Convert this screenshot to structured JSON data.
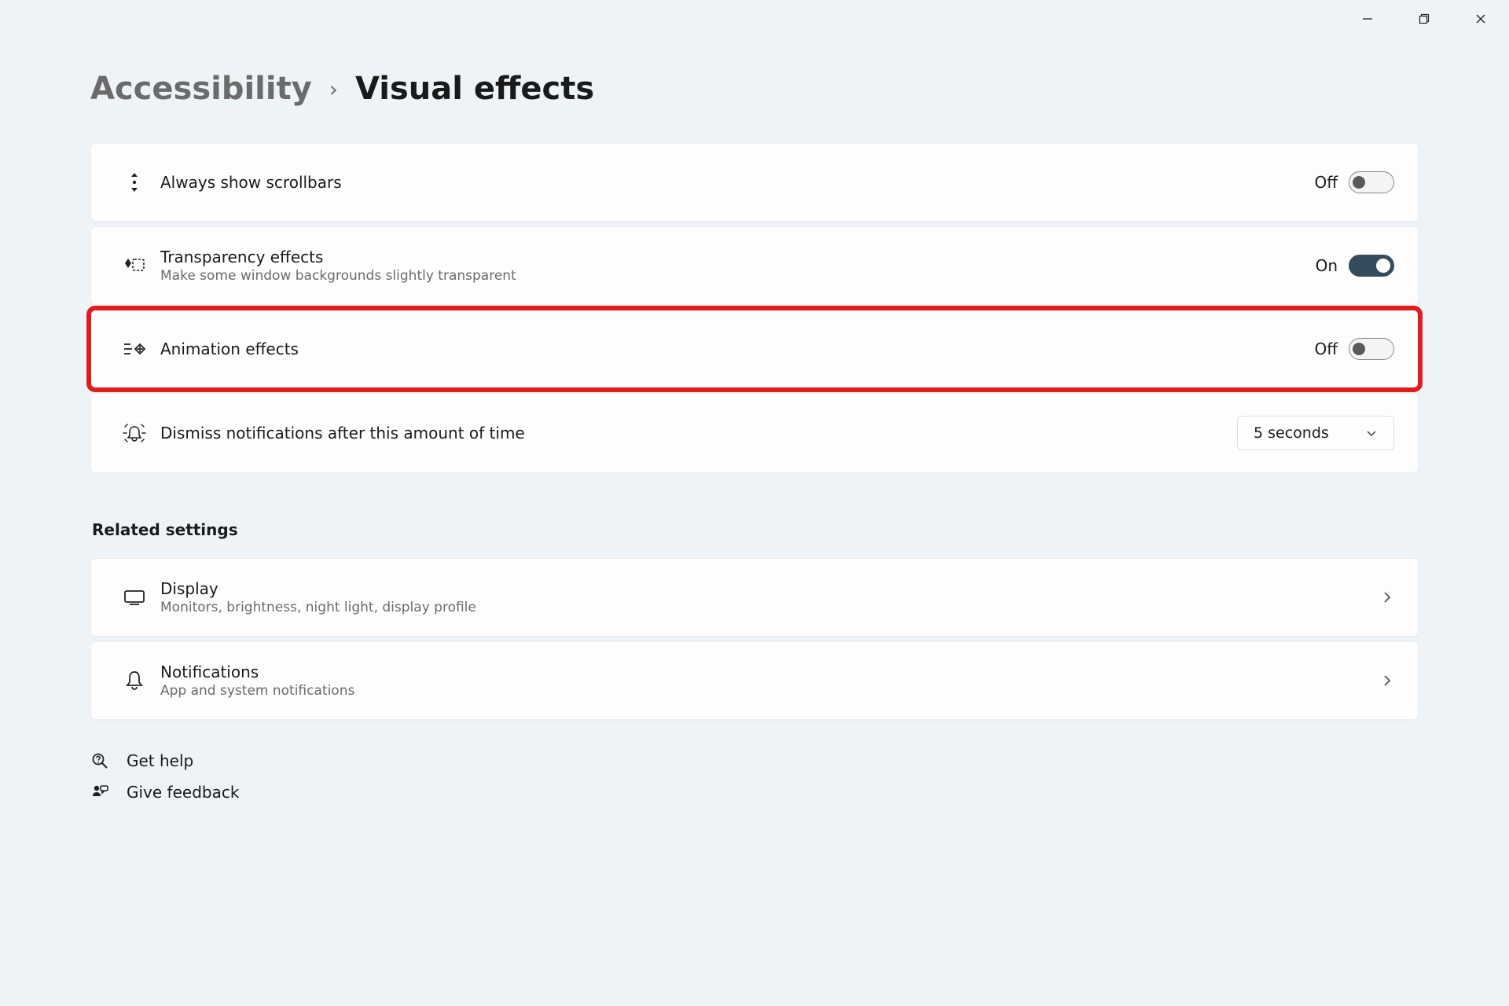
{
  "breadcrumb": {
    "root": "Accessibility",
    "leaf": "Visual effects"
  },
  "settings": {
    "scrollbars": {
      "title": "Always show scrollbars",
      "state_label": "Off",
      "state": "off"
    },
    "transparency": {
      "title": "Transparency effects",
      "sub": "Make some window backgrounds slightly transparent",
      "state_label": "On",
      "state": "on"
    },
    "animation": {
      "title": "Animation effects",
      "state_label": "Off",
      "state": "off"
    },
    "notifications_time": {
      "title": "Dismiss notifications after this amount of time",
      "value": "5 seconds"
    }
  },
  "related_header": "Related settings",
  "related": {
    "display": {
      "title": "Display",
      "sub": "Monitors, brightness, night light, display profile"
    },
    "notifications": {
      "title": "Notifications",
      "sub": "App and system notifications"
    }
  },
  "help": {
    "get_help": "Get help",
    "feedback": "Give feedback"
  }
}
